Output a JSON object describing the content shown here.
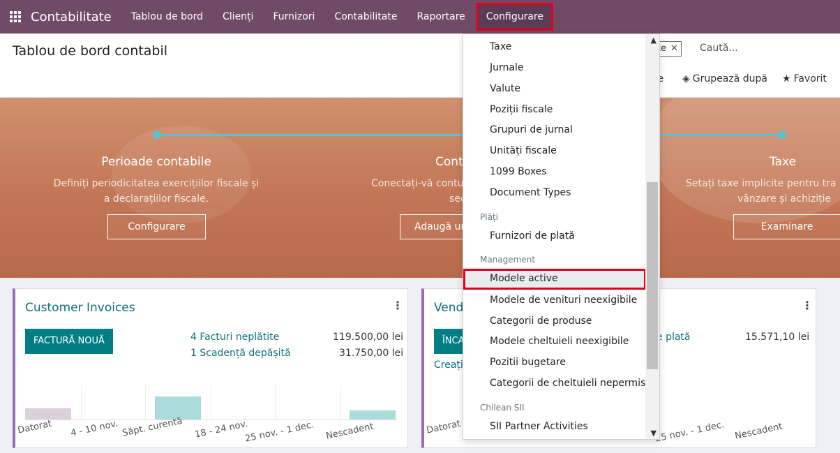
{
  "navbar": {
    "app_name": "Contabilitate",
    "items": [
      "Tablou de bord",
      "Clienți",
      "Furnizori",
      "Contabilitate",
      "Raportare",
      "Configurare"
    ]
  },
  "control": {
    "title": "Tablou de bord contabil",
    "facet": "orite",
    "search_placeholder": "Caută...",
    "filters_partial": "re",
    "group_by": "Grupează după",
    "favorites_partial": "Favorit"
  },
  "banner": {
    "steps": [
      {
        "title": "Perioade contabile",
        "desc1": "Definiți periodicitatea exercițiilor fiscale și",
        "desc2": "a declarațiilor fiscale.",
        "button": "Configurare"
      },
      {
        "title": "Cont",
        "desc1": "Conectați-vă contur",
        "desc2": "sec",
        "button": "Adaugă un"
      },
      {
        "title": "Taxe",
        "desc1": "Setați taxe implicite pentru tra",
        "desc2": "vânzare și achiziție",
        "button": "Examinare"
      }
    ]
  },
  "card_invoices": {
    "title": "Customer Invoices",
    "button": "FACTURĂ NOUĂ",
    "link1": "4 Facturi neplătite",
    "amount1": "119.500,00 lei",
    "link2": "1 Scadență depășită",
    "amount2": "31.750,00 lei",
    "labels": [
      "Datorat",
      "4 - 10 nov.",
      "Săpt. curentă",
      "18 - 24 nov.",
      "25 nov. - 1 dec.",
      "Nescadent"
    ]
  },
  "card_vendor": {
    "title": "Vend",
    "button": "ÎNCA",
    "create_partial": "Creați",
    "link1": "e plată",
    "amount1": "15.571,10 lei",
    "labels": [
      "Datorat",
      "25 nov. - 1 dec.",
      "Nescadent"
    ]
  },
  "dropdown": {
    "items": [
      {
        "label": "Taxe"
      },
      {
        "label": "Jurnale"
      },
      {
        "label": "Valute"
      },
      {
        "label": "Poziții fiscale"
      },
      {
        "label": "Grupuri de jurnal"
      },
      {
        "label": "Unități fiscale"
      },
      {
        "label": "1099 Boxes"
      },
      {
        "label": "Document Types"
      }
    ],
    "section_payments": "Plăți",
    "payments_items": [
      "Furnizori de plată"
    ],
    "section_management": "Management",
    "management_items": [
      "Modele active",
      "Modele de venituri neexigibile",
      "Categorii de produse",
      "Modele cheltuieli neexigibile",
      "Pozitii bugetare",
      "Categorii de cheltuieli nepermise"
    ],
    "section_chilean": "Chilean SII",
    "chilean_items": [
      "SII Partner Activities"
    ]
  },
  "colors": {
    "navbar": "#704a66",
    "accent": "#017e84",
    "highlight_border": "#e3001b"
  }
}
